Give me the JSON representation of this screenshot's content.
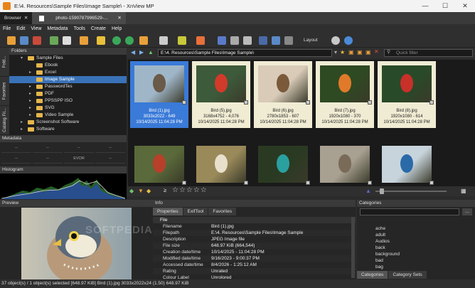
{
  "window": {
    "title": "E:\\4. Resources\\Sample Files\\Image Sample\\ - XnView MP",
    "min": "—",
    "max": "☐",
    "close": "✕"
  },
  "tabs": [
    {
      "label": "Browser"
    },
    {
      "label": "photo-1590787996529-..."
    }
  ],
  "menu": [
    "File",
    "Edit",
    "View",
    "Metadata",
    "Tools",
    "Create",
    "Help"
  ],
  "toolbar": {
    "layout_label": "Layout"
  },
  "sidetabs": [
    "Fold...",
    "Favorites",
    "Catalog Fil..."
  ],
  "folders": {
    "title": "Folders",
    "items": [
      {
        "label": "Sample Files",
        "indent": 1,
        "selected": false
      },
      {
        "label": "Ebook",
        "indent": 2,
        "selected": false
      },
      {
        "label": "Excel",
        "indent": 2,
        "selected": false
      },
      {
        "label": "Image Sample",
        "indent": 2,
        "selected": true
      },
      {
        "label": "PasswordTes",
        "indent": 2,
        "selected": false
      },
      {
        "label": "PDF",
        "indent": 2,
        "selected": false
      },
      {
        "label": "PPSSPP ISO",
        "indent": 2,
        "selected": false
      },
      {
        "label": "SVG",
        "indent": 2,
        "selected": false
      },
      {
        "label": "Video Sample",
        "indent": 2,
        "selected": false
      },
      {
        "label": "Screenshot Software",
        "indent": 1,
        "selected": false
      },
      {
        "label": "Software",
        "indent": 1,
        "selected": false
      }
    ]
  },
  "metadata": {
    "title": "Metadata",
    "cells": [
      "--",
      "--",
      "--",
      "--",
      "--",
      "--",
      "EVOR",
      "--"
    ]
  },
  "histogram": {
    "title": "Histogram"
  },
  "preview": {
    "title": "Preview",
    "watermark": "SOFTPEDIA"
  },
  "nav": {
    "path": "E:\\4. Resources\\Sample Files\\Image Sample\\",
    "quick_filter": "Quick filter"
  },
  "thumbnails": [
    {
      "name": "Bird (1).jpg",
      "dims": "3033x2022 - 649",
      "date": "10/14/2025 11:04:28 PM",
      "selected": true,
      "sky": "#9fb6c8",
      "fg": "#6a5a48"
    },
    {
      "name": "Bird (5).jpg",
      "dims": "3168x4752 - 4,076",
      "date": "10/14/2025 11:04:28 PM",
      "selected": false,
      "sky": "#3d5a3a",
      "fg": "#d23a2a"
    },
    {
      "name": "Bird (6).jpg",
      "dims": "2780x1853 - 607",
      "date": "10/14/2025 11:04:28 PM",
      "selected": false,
      "sky": "#d9cbb8",
      "fg": "#7a5a3a"
    },
    {
      "name": "Bird (7).jpg",
      "dims": "1920x1080 - 370",
      "date": "10/14/2025 11:04:28 PM",
      "selected": false,
      "sky": "#2e4a22",
      "fg": "#e07a2a"
    },
    {
      "name": "Bird (8).jpg",
      "dims": "1920x1080 - 614",
      "date": "10/14/2025 11:04:28 PM",
      "selected": false,
      "sky": "#294a28",
      "fg": "#c8302a"
    },
    {
      "name": "",
      "dims": "",
      "date": "",
      "selected": false,
      "sky": "#5a6a3a",
      "fg": "#b8402a"
    },
    {
      "name": "",
      "dims": "",
      "date": "",
      "selected": false,
      "sky": "#9a8a5a",
      "fg": "#e8e0cc"
    },
    {
      "name": "",
      "dims": "",
      "date": "",
      "selected": false,
      "sky": "#2a3a22",
      "fg": "#2aa0a0"
    },
    {
      "name": "",
      "dims": "",
      "date": "",
      "selected": false,
      "sky": "#a8a090",
      "fg": "#7a6a58"
    },
    {
      "name": "",
      "dims": "",
      "date": "",
      "selected": false,
      "sky": "#c8d4dc",
      "fg": "#2a6aa8"
    }
  ],
  "info": {
    "title": "Info",
    "tabs": [
      "Properties",
      "ExifTool",
      "Favorites"
    ],
    "section": "File",
    "rows": [
      {
        "k": "Filename",
        "v": "Bird (1).jpg"
      },
      {
        "k": "Filepath",
        "v": "E:\\4. Resources\\Sample Files\\Image Sample"
      },
      {
        "k": "Description",
        "v": "JPEG Image file"
      },
      {
        "k": "File size",
        "v": "648.97 KiB (664,544)"
      },
      {
        "k": "Creation date/time",
        "v": "10/14/2025 - 11:04:28 PM"
      },
      {
        "k": "Modified date/time",
        "v": "9/16/2023 - 9:00:37 PM"
      },
      {
        "k": "Accessed date/time",
        "v": "8/4/2026 - 1:25:12 AM"
      },
      {
        "k": "Rating",
        "v": "Unrated"
      },
      {
        "k": "Colour Label",
        "v": "Unrolored"
      }
    ]
  },
  "categories": {
    "title": "Categories",
    "items": [
      "ache",
      "adult",
      "Audios",
      "back",
      "background",
      "bad",
      "bag"
    ],
    "tabs": [
      "Categories",
      "Category Sets"
    ]
  },
  "status": "37 object(s) / 1 object(s) selected [648.97 KiB]   Bird (1).jpg   3033x2022x24 (1.50)   648.97 KiB"
}
